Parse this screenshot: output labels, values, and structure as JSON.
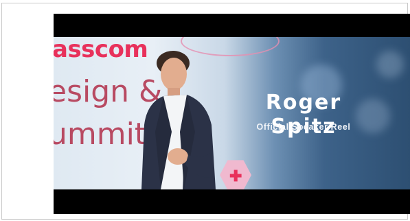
{
  "video": {
    "backdrop_brand": "asscom",
    "backdrop_line_1": "esign &",
    "backdrop_line_2": "ummit",
    "title": "Roger Spitz",
    "subtitle": "Official Speaker Reel"
  }
}
